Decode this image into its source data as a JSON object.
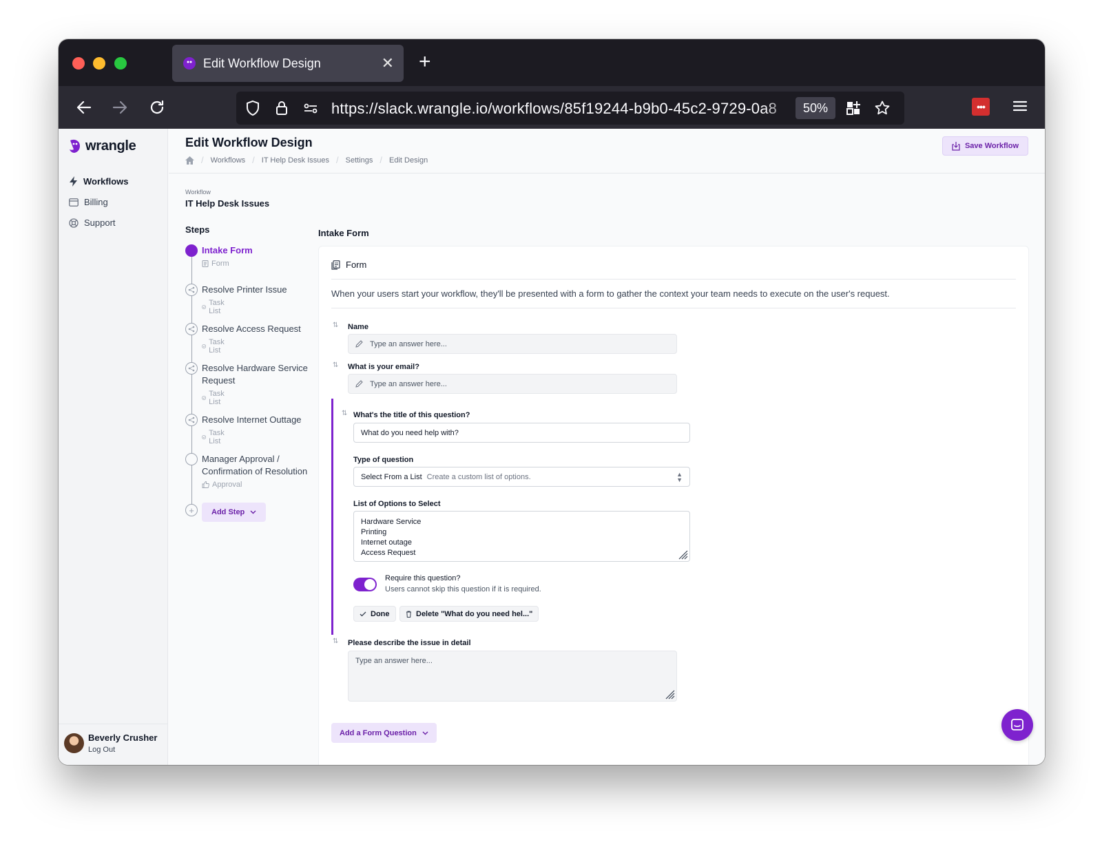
{
  "browser": {
    "tab_title": "Edit Workflow Design",
    "url": "https://slack.wrangle.io/workflows/85f19244-b9b0-45c2-9729-0a8",
    "zoom": "50%"
  },
  "brand": {
    "logo_text": "wrangle",
    "accent_color": "#7e22ce"
  },
  "sidebar": {
    "items": [
      {
        "label": "Workflows",
        "icon": "bolt-icon"
      },
      {
        "label": "Billing",
        "icon": "credit-card-icon"
      },
      {
        "label": "Support",
        "icon": "lifebuoy-icon"
      }
    ],
    "user": {
      "name": "Beverly Crusher",
      "logout": "Log Out"
    }
  },
  "header": {
    "title": "Edit Workflow Design",
    "breadcrumbs": [
      "Workflows",
      "IT Help Desk Issues",
      "Settings",
      "Edit Design"
    ],
    "save_label": "Save Workflow"
  },
  "workflow": {
    "label": "Workflow",
    "name": "IT Help Desk Issues"
  },
  "steps": {
    "title": "Steps",
    "items": [
      {
        "name": "Intake Form",
        "type": "Form"
      },
      {
        "name": "Resolve Printer Issue",
        "type": "Task List"
      },
      {
        "name": "Resolve Access Request",
        "type": "Task List"
      },
      {
        "name": "Resolve Hardware Service Request",
        "type": "Task List"
      },
      {
        "name": "Resolve Internet Outtage",
        "type": "Task List"
      },
      {
        "name": "Manager Approval / Confirmation of Resolution",
        "type": "Approval"
      }
    ],
    "add_label": "Add Step"
  },
  "form": {
    "section_title": "Intake Form",
    "card_title": "Form",
    "description": "When your users start your workflow, they'll be presented with a form to gather the context your team needs to execute on the user's request.",
    "answer_placeholder": "Type an answer here...",
    "questions": [
      {
        "label": "Name"
      },
      {
        "label": "What is your email?"
      }
    ],
    "editing": {
      "title_label": "What's the title of this question?",
      "title_value": "What do you need help with?",
      "type_label": "Type of question",
      "type_value": "Select From a List",
      "type_hint": "Create a custom list of options.",
      "options_label": "List of Options to Select",
      "options": [
        "Hardware Service",
        "Printing",
        "Internet outage",
        "Access Request"
      ],
      "require_title": "Require this question?",
      "require_hint": "Users cannot skip this question if it is required.",
      "required": true,
      "done_label": "Done",
      "delete_label": "Delete \"What do you need hel...\""
    },
    "detail_question": {
      "label": "Please describe the issue in detail"
    },
    "add_question_label": "Add a Form Question"
  }
}
